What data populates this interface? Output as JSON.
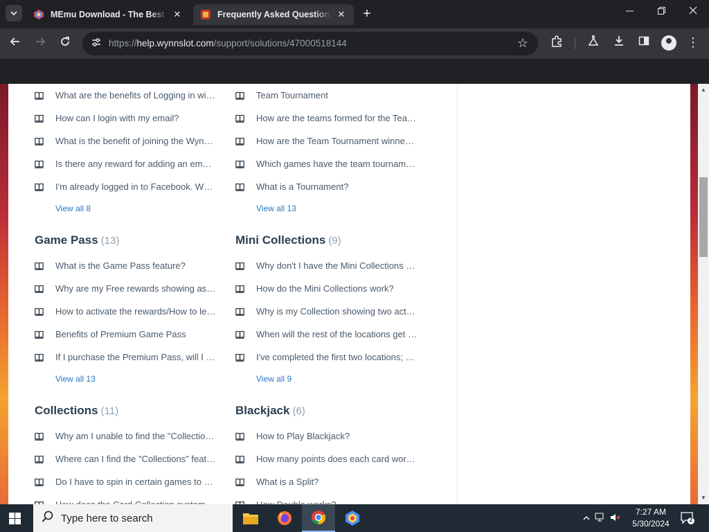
{
  "browser": {
    "tabs": [
      {
        "title": "MEmu Download - The Best Android Emulator",
        "close": "✕"
      },
      {
        "title": "Frequently Asked Questions (FAQ)",
        "close": "✕"
      }
    ],
    "new_tab": "+",
    "url_prefix": "https://",
    "url_host": "help.wynnslot.com",
    "url_path": "/support/solutions/47000518144"
  },
  "categories": [
    {
      "title": "",
      "count": "",
      "articles": [
        "What are the benefits of Logging in with Facebook?",
        "How can I login with my email?",
        "What is the benefit of joining the Wynnslot community?",
        "Is there any reward for adding an email?",
        "I'm already logged in to Facebook. What do I do?"
      ],
      "view_all": "View all 8"
    },
    {
      "title": "",
      "count": "",
      "articles": [
        "Team Tournament",
        "How are the teams formed for the Team Tournament?",
        "How are the Team Tournament winners decided?",
        "Which games have the team tournament?",
        "What is a Tournament?"
      ],
      "view_all": "View all 13"
    },
    {
      "title": "Game Pass",
      "count": "(13)",
      "articles": [
        "What is the Game Pass feature?",
        "Why are my Free rewards showing as locked?",
        "How to activate the rewards/How to level up?",
        "Benefits of Premium Game Pass",
        "If I purchase the Premium Pass, will I get rewards?"
      ],
      "view_all": "View all 13"
    },
    {
      "title": "Mini Collections",
      "count": "(9)",
      "articles": [
        "Why don't I have the Mini Collections feature?",
        "How do the Mini Collections work?",
        "Why is my Collection showing two active locations?",
        "When will the rest of the locations get unlocked?",
        "I've completed the first two locations; what next?"
      ],
      "view_all": "View all 9"
    },
    {
      "title": "Collections",
      "count": "(11)",
      "articles": [
        "Why am I unable to find the \"Collections\" feature?",
        "Where can I find the \"Collections\" feature?",
        "Do I have to spin in certain games to get cards?",
        "How does the Card Collection system work?"
      ],
      "view_all": ""
    },
    {
      "title": "Blackjack",
      "count": "(6)",
      "articles": [
        "How to Play Blackjack?",
        "How many points does each card worth?",
        "What is a Split?",
        "How Double works?"
      ],
      "view_all": ""
    }
  ],
  "taskbar": {
    "search_placeholder": "Type here to search",
    "time": "7:27 AM",
    "date": "5/30/2024",
    "notification_count": "2"
  },
  "colors": {
    "link": "#2d74c7",
    "category_title": "#2c3e50",
    "article_text": "#4a5a6a",
    "count": "#92a2b1"
  }
}
